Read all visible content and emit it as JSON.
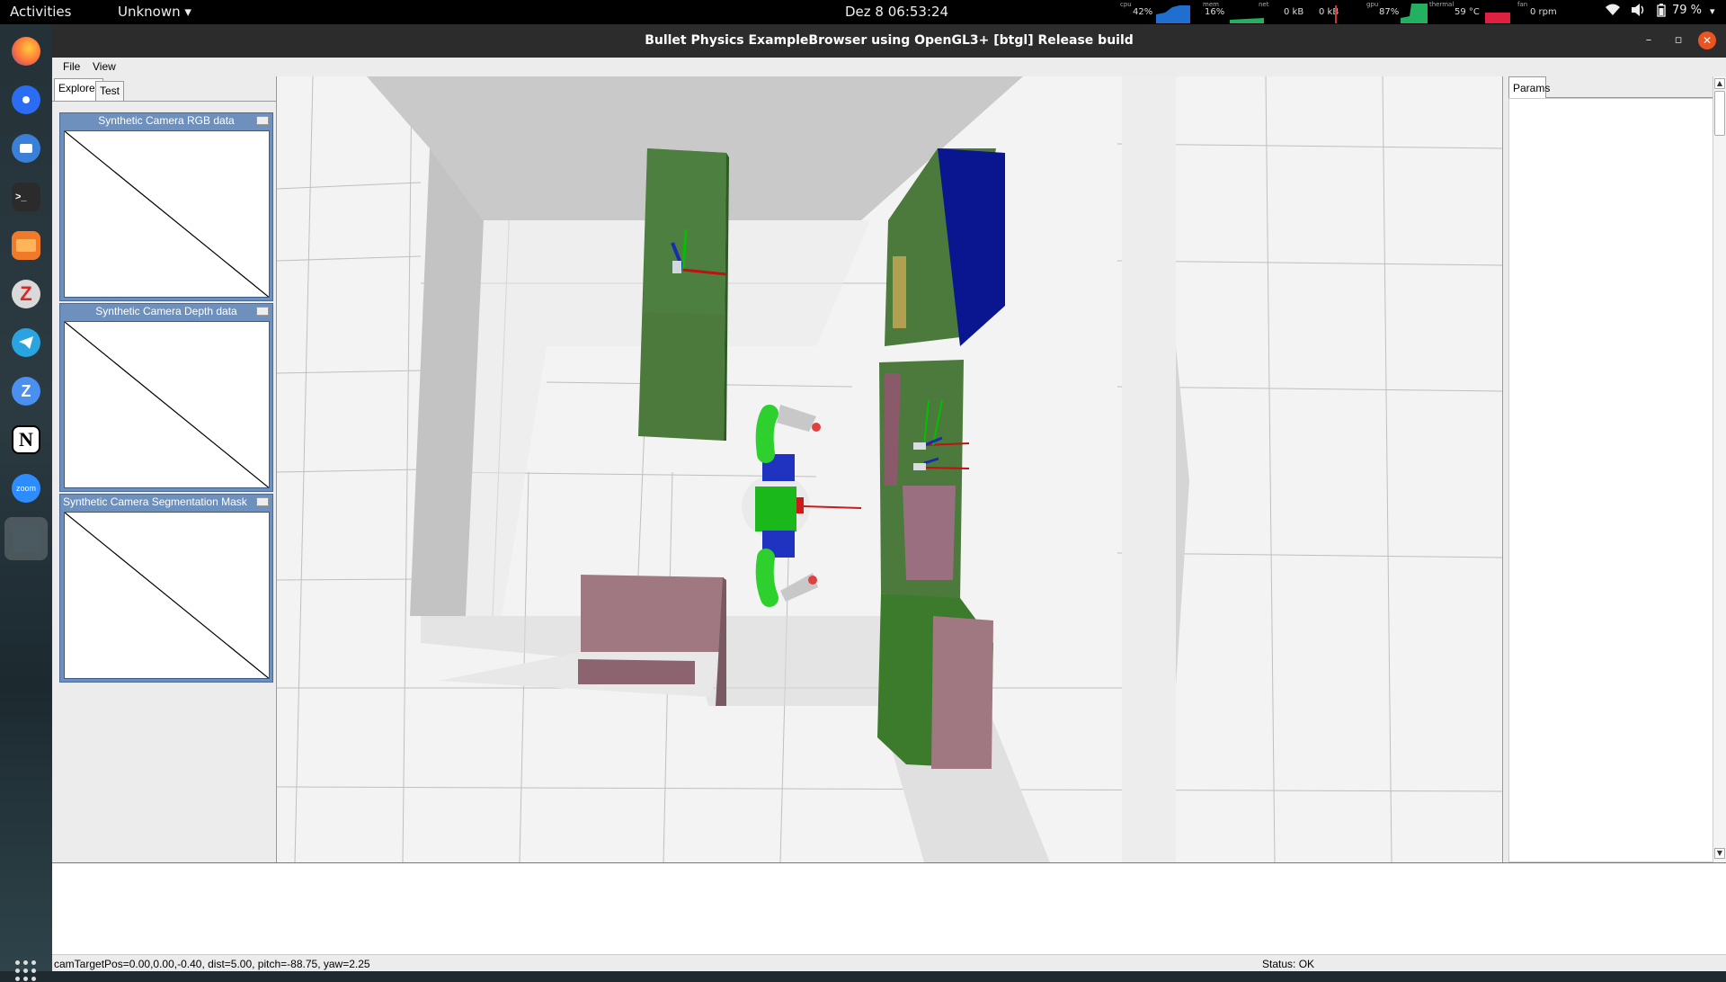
{
  "topbar": {
    "activities": "Activities",
    "app_menu": "Unknown",
    "clock": "Dez 8  06:53:24",
    "monitors": [
      {
        "label": "cpu",
        "value": "42%",
        "color": "#1e6fd0"
      },
      {
        "label": "mem",
        "value": "16%",
        "color": "#23b060"
      },
      {
        "label": "net",
        "value": "0 kB",
        "color": "#f0a000"
      },
      {
        "label": "",
        "value": "0 kB",
        "color": "#cc3333"
      },
      {
        "label": "gpu",
        "value": "87%",
        "color": "#23b060"
      },
      {
        "label": "thermal",
        "value": "59 °C",
        "color": "#e02040"
      },
      {
        "label": "fan",
        "value": "0 rpm",
        "color": "#888888"
      }
    ],
    "battery": "79 %"
  },
  "dock": {
    "icons": [
      "firefox-icon",
      "chromium-icon",
      "thunderbird-icon",
      "terminal-icon",
      "files-icon",
      "zotero-icon",
      "telegram-icon",
      "zulip-icon",
      "notion-icon",
      "zoom-icon",
      "active-app-icon"
    ],
    "zoom_label": "zoom"
  },
  "window": {
    "title": "Bullet Physics ExampleBrowser using OpenGL3+ [btgl] Release build"
  },
  "menu": {
    "file": "File",
    "view": "View"
  },
  "explorer": {
    "tabs": [
      "Explorer",
      "Test"
    ],
    "panels": [
      "Synthetic Camera RGB data",
      "Synthetic Camera Depth data",
      "Synthetic Camera Segmentation Mask"
    ]
  },
  "params": {
    "tab": "Params"
  },
  "status": {
    "camera": "camTargetPos=0.00,0.00,-0.40, dist=5.00, pitch=-88.75, yaw=2.25",
    "state": "Status: OK"
  }
}
